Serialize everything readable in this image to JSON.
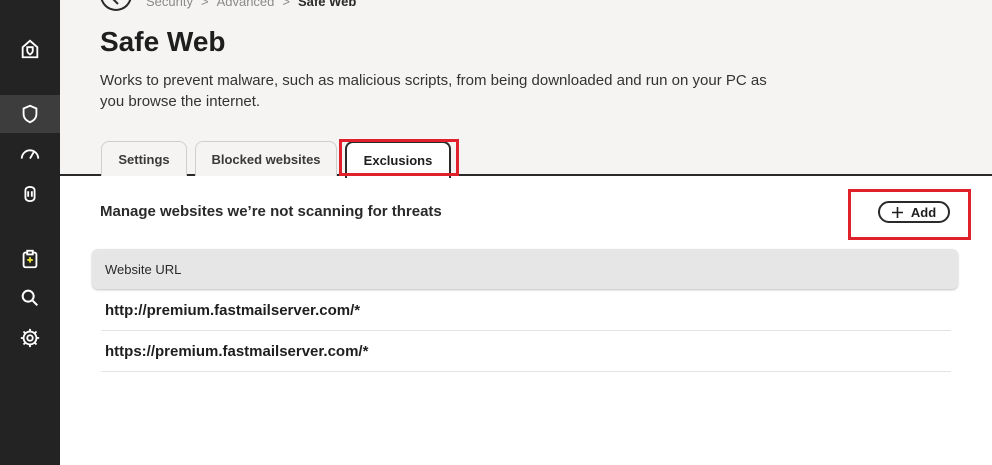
{
  "sidebar": {
    "items": [
      {
        "icon": "home-shield-icon",
        "active": false
      },
      {
        "icon": "shield-icon",
        "active": true
      },
      {
        "icon": "speedometer-icon",
        "active": false
      },
      {
        "icon": "fingerprint-icon",
        "active": false
      },
      {
        "icon": "clipboard-plus-icon",
        "active": false
      },
      {
        "icon": "search-icon",
        "active": false
      },
      {
        "icon": "gear-icon",
        "active": false
      }
    ]
  },
  "breadcrumb": {
    "items": [
      "Security",
      "Advanced",
      "Safe Web"
    ],
    "separator": ">"
  },
  "page": {
    "title": "Safe Web",
    "description": "Works to prevent malware, such as malicious scripts, from being downloaded and run on your PC as you browse the internet."
  },
  "tabs": [
    {
      "label": "Settings",
      "active": false
    },
    {
      "label": "Blocked websites",
      "active": false
    },
    {
      "label": "Exclusions",
      "active": true
    }
  ],
  "exclusions": {
    "heading": "Manage websites we’re not scanning for threats",
    "add_label": "Add",
    "column_header": "Website URL",
    "rows": [
      "http://premium.fastmailserver.com/*",
      "https://premium.fastmailserver.com/*"
    ]
  },
  "colors": {
    "highlight": "#e0202a",
    "sidebar": "#232323",
    "header_bg": "#f5f4f2"
  }
}
